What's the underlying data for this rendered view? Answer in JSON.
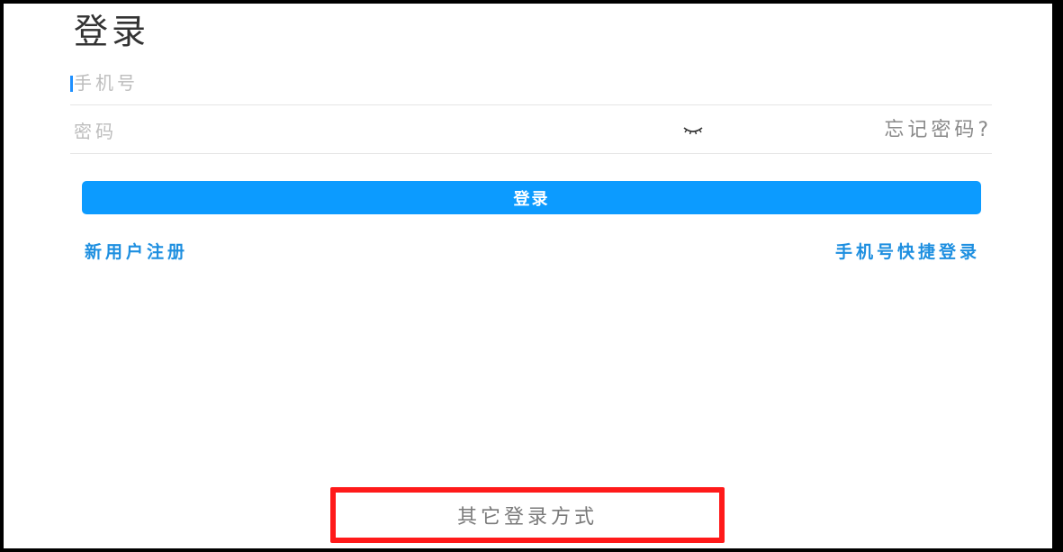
{
  "title": "登录",
  "phone_field": {
    "placeholder": "手机号",
    "value": ""
  },
  "password_field": {
    "placeholder": "密码",
    "value": "",
    "toggle_icon": "eye-closed-icon"
  },
  "forgot_password_label": "忘记密码?",
  "login_button_label": "登录",
  "register_link_label": "新用户注册",
  "quick_login_link_label": "手机号快捷登录",
  "other_login_label": "其它登录方式",
  "colors": {
    "primary": "#0c9bff",
    "link": "#1e8fe0",
    "highlight_box": "#ff1a1a"
  }
}
